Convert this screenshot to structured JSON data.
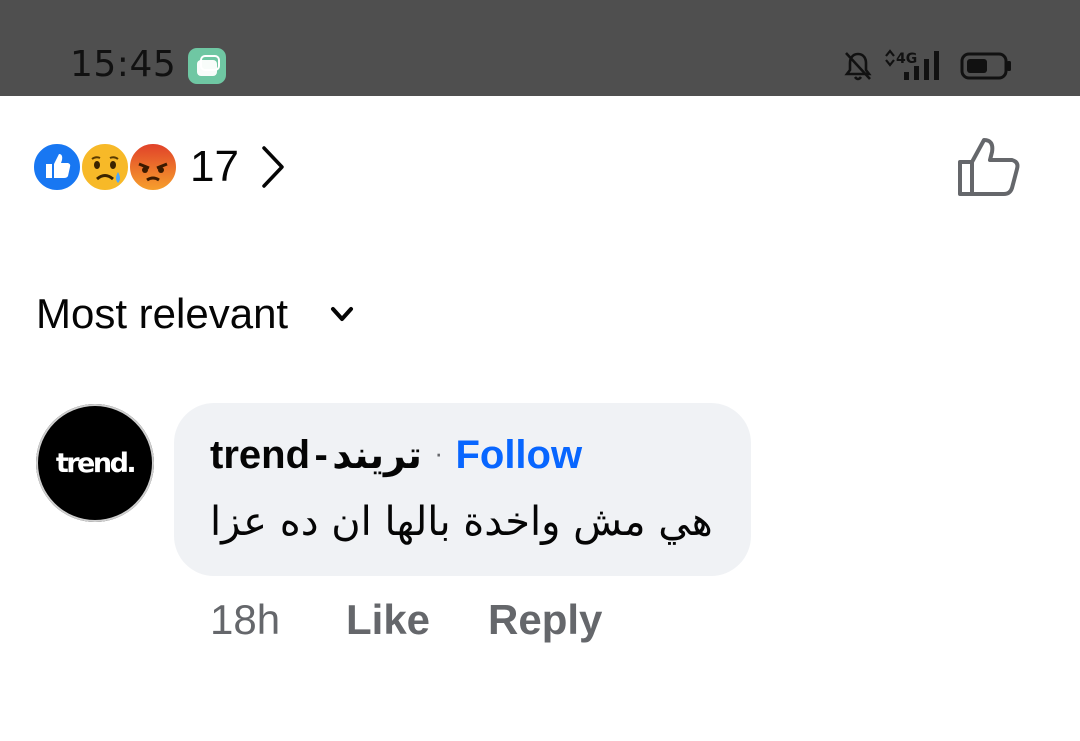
{
  "status_bar": {
    "time": "15:45",
    "network": "4G"
  },
  "reactions": {
    "types": [
      "like-icon",
      "sad-icon",
      "angry-icon"
    ],
    "count": "17"
  },
  "sort": {
    "label": "Most relevant"
  },
  "comment": {
    "avatar_text": "trend.",
    "author_name": "trend",
    "author_separator": "-",
    "author_arabic": "تريند",
    "dot": "·",
    "follow_label": "Follow",
    "text": "هي مش واخدة بالها ان ده عزا",
    "timestamp": "18h",
    "like_label": "Like",
    "reply_label": "Reply"
  },
  "colors": {
    "status_bar_bg": "#4f4f4f",
    "follow_blue": "#0866ff",
    "bubble_bg": "#f0f2f5",
    "secondary_text": "#65676b"
  }
}
